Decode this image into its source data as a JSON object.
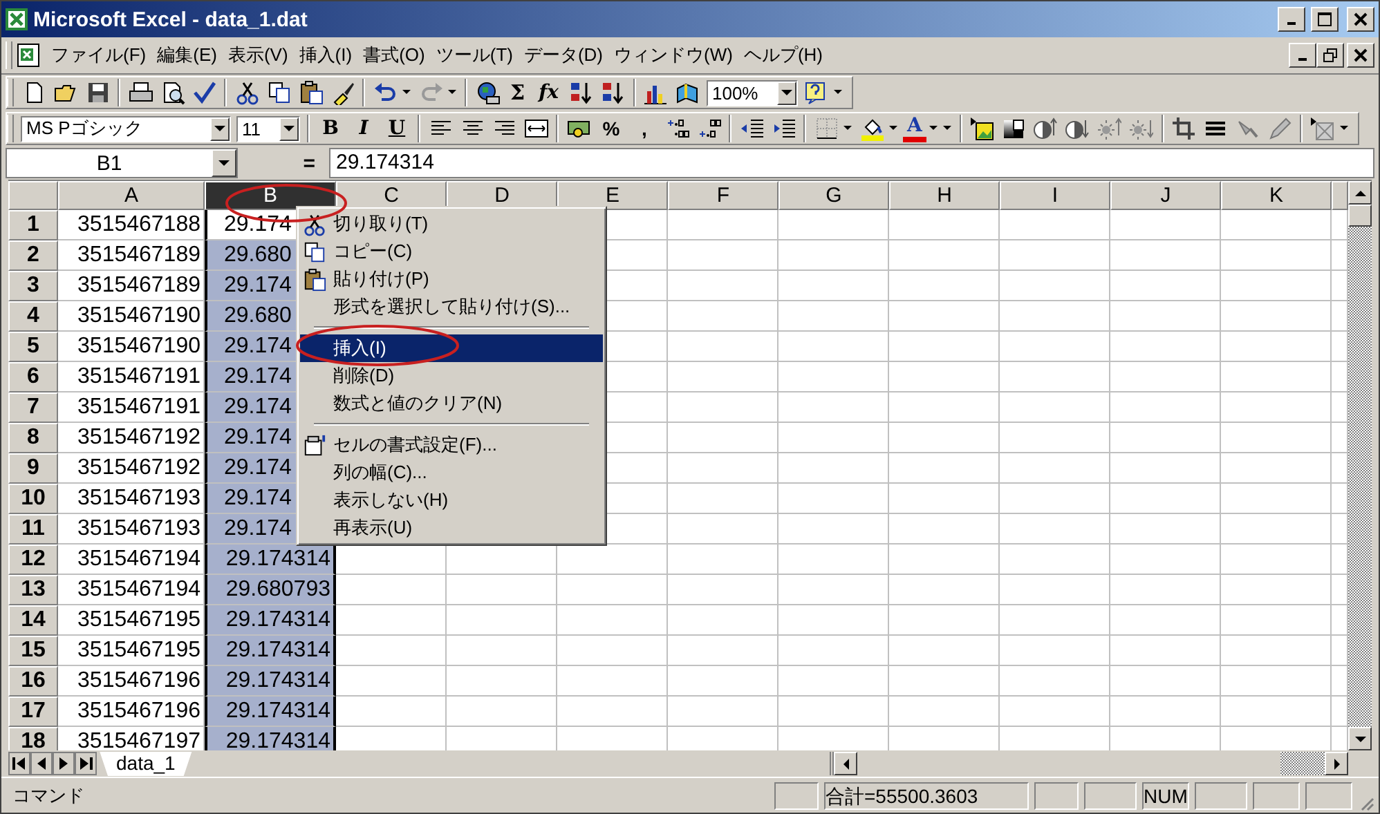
{
  "window": {
    "title": "Microsoft Excel - data_1.dat"
  },
  "menu_bar": [
    "ファイル(F)",
    "編集(E)",
    "表示(V)",
    "挿入(I)",
    "書式(O)",
    "ツール(T)",
    "データ(D)",
    "ウィンドウ(W)",
    "ヘルプ(H)"
  ],
  "standard_toolbar": {
    "sum_button": "Σ",
    "function_button": "fx",
    "zoom": "100%"
  },
  "formatting_toolbar": {
    "font": "MS Pゴシック",
    "size": "11",
    "style_buttons": [
      "B",
      "I",
      "U"
    ],
    "number_buttons": [
      "%",
      ","
    ],
    "font_color_button": "A"
  },
  "formula_bar": {
    "name_box": "B1",
    "equals": "=",
    "value": "29.174314"
  },
  "sheet": {
    "columns": [
      {
        "label": "A",
        "selected": false
      },
      {
        "label": "B",
        "selected": true
      },
      {
        "label": "C",
        "selected": false
      },
      {
        "label": "D",
        "selected": false
      },
      {
        "label": "E",
        "selected": false
      },
      {
        "label": "F",
        "selected": false
      },
      {
        "label": "G",
        "selected": false
      },
      {
        "label": "H",
        "selected": false
      },
      {
        "label": "I",
        "selected": false
      },
      {
        "label": "J",
        "selected": false
      },
      {
        "label": "K",
        "selected": false
      }
    ],
    "rows": [
      {
        "number": "1",
        "active": true,
        "cells": [
          "3515467188",
          "29.174"
        ]
      },
      {
        "number": "2",
        "active": false,
        "cells": [
          "3515467189",
          "29.680"
        ]
      },
      {
        "number": "3",
        "active": false,
        "cells": [
          "3515467189",
          "29.174"
        ]
      },
      {
        "number": "4",
        "active": false,
        "cells": [
          "3515467190",
          "29.680"
        ]
      },
      {
        "number": "5",
        "active": false,
        "cells": [
          "3515467190",
          "29.174"
        ]
      },
      {
        "number": "6",
        "active": false,
        "cells": [
          "3515467191",
          "29.174"
        ]
      },
      {
        "number": "7",
        "active": false,
        "cells": [
          "3515467191",
          "29.174"
        ]
      },
      {
        "number": "8",
        "active": false,
        "cells": [
          "3515467192",
          "29.174"
        ]
      },
      {
        "number": "9",
        "active": false,
        "cells": [
          "3515467192",
          "29.174"
        ]
      },
      {
        "number": "10",
        "active": false,
        "cells": [
          "3515467193",
          "29.174"
        ]
      },
      {
        "number": "11",
        "active": false,
        "cells": [
          "3515467193",
          "29.174"
        ]
      },
      {
        "number": "12",
        "active": false,
        "cells": [
          "3515467194",
          "29.174314"
        ]
      },
      {
        "number": "13",
        "active": false,
        "cells": [
          "3515467194",
          "29.680793"
        ]
      },
      {
        "number": "14",
        "active": false,
        "cells": [
          "3515467195",
          "29.174314"
        ]
      },
      {
        "number": "15",
        "active": false,
        "cells": [
          "3515467195",
          "29.174314"
        ]
      },
      {
        "number": "16",
        "active": false,
        "cells": [
          "3515467196",
          "29.174314"
        ]
      },
      {
        "number": "17",
        "active": false,
        "cells": [
          "3515467196",
          "29.174314"
        ]
      },
      {
        "number": "18",
        "active": false,
        "cells": [
          "3515467197",
          "29.174314"
        ]
      }
    ]
  },
  "context_menu": {
    "items": [
      {
        "kind": "item",
        "label": "切り取り(T)",
        "selected": false
      },
      {
        "kind": "item",
        "label": "コピー(C)",
        "selected": false
      },
      {
        "kind": "item",
        "label": "貼り付け(P)",
        "selected": false
      },
      {
        "kind": "item",
        "label": "形式を選択して貼り付け(S)...",
        "selected": false
      },
      {
        "kind": "separator"
      },
      {
        "kind": "item",
        "label": "挿入(I)",
        "selected": true
      },
      {
        "kind": "item",
        "label": "削除(D)",
        "selected": false
      },
      {
        "kind": "item",
        "label": "数式と値のクリア(N)",
        "selected": false
      },
      {
        "kind": "separator"
      },
      {
        "kind": "item",
        "label": "セルの書式設定(F)...",
        "selected": false
      },
      {
        "kind": "item",
        "label": "列の幅(C)...",
        "selected": false
      },
      {
        "kind": "item",
        "label": "表示しない(H)",
        "selected": false
      },
      {
        "kind": "item",
        "label": "再表示(U)",
        "selected": false
      }
    ]
  },
  "sheet_tabs": [
    {
      "label": "data_1",
      "selected": true
    }
  ],
  "status_bar": {
    "mode": "コマンド",
    "sum": "合計=55500.3603",
    "num_lock": "NUM"
  }
}
